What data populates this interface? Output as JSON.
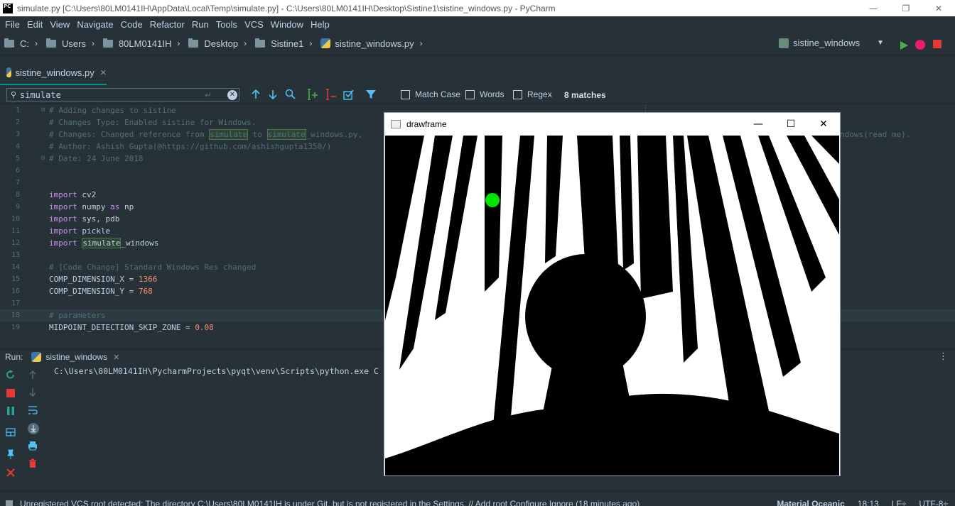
{
  "window": {
    "title": "simulate.py [C:\\Users\\80LM0141IH\\AppData\\Local\\Temp\\simulate.py] - C:\\Users\\80LM0141IH\\Desktop\\Sistine1\\sistine_windows.py - PyCharm",
    "logo_text": "PC",
    "minimize": "—",
    "restore": "❐",
    "close": "✕"
  },
  "menu": [
    "File",
    "Edit",
    "View",
    "Navigate",
    "Code",
    "Refactor",
    "Run",
    "Tools",
    "VCS",
    "Window",
    "Help"
  ],
  "breadcrumb": [
    "C:",
    "Users",
    "80LM0141IH",
    "Desktop",
    "Sistine1",
    "sistine_windows.py"
  ],
  "run_config": {
    "name": "sistine_windows",
    "dropdown": "▼"
  },
  "editor_tab": {
    "label": "sistine_windows.py",
    "close": "✕"
  },
  "search": {
    "query": "simulate",
    "enter_glyph": "↵",
    "clear_glyph": "✕",
    "options": [
      "Match Case",
      "Words",
      "Regex"
    ],
    "matches": "8 matches"
  },
  "code_lines": [
    {
      "n": "1",
      "text": "# Adding changes to sistine"
    },
    {
      "n": "2",
      "text": "# Changes Type: Enabled sistine for Windows."
    },
    {
      "n": "3",
      "text": "# Changes: Changed reference from simulate to simulate_windows.py,",
      "tail": "ndows(read me)."
    },
    {
      "n": "4",
      "text": "# Author: Ashish Gupta(@https://github.com/ashishgupta1350/)"
    },
    {
      "n": "5",
      "text": "# Date: 24 June 2018"
    },
    {
      "n": "6",
      "text": ""
    },
    {
      "n": "7",
      "text": ""
    },
    {
      "n": "8",
      "text": "import cv2"
    },
    {
      "n": "9",
      "text": "import numpy as np"
    },
    {
      "n": "10",
      "text": "import sys, pdb"
    },
    {
      "n": "11",
      "text": "import pickle"
    },
    {
      "n": "12",
      "text": "import simulate_windows"
    },
    {
      "n": "13",
      "text": ""
    },
    {
      "n": "14",
      "text": "# [Code Change] Standard Windows Res changed"
    },
    {
      "n": "15",
      "text": "COMP_DIMENSION_X = 1366"
    },
    {
      "n": "16",
      "text": "COMP_DIMENSION_Y = 768"
    },
    {
      "n": "17",
      "text": ""
    },
    {
      "n": "18",
      "text": "# parameters"
    },
    {
      "n": "19",
      "text": "MIDPOINT_DETECTION_SKIP_ZONE = 0.08"
    }
  ],
  "run_panel": {
    "label": "Run:",
    "tab": "sistine_windows",
    "close": "✕",
    "output": "C:\\Users\\80LM0141IH\\PycharmProjects\\pyqt\\venv\\Scripts\\python.exe C"
  },
  "status": {
    "message": "Unregistered VCS root detected: The directory C:\\Users\\80LM0141IH is under Git, but is not registered in the Settings. // Add root  Configure  Ignore (18 minutes ago)",
    "theme": "Material Oceanic",
    "position": "18:13",
    "line_sep": "LF÷",
    "encoding": "UTF-8÷"
  },
  "cv_window": {
    "title": "drawframe",
    "minimize": "—",
    "maximize": "☐",
    "close": "✕"
  },
  "colors": {
    "bg": "#263238",
    "text": "#c3cee3",
    "comment": "#546e7a",
    "keyword": "#c792ea",
    "number": "#f78c6c",
    "accent": "#009688",
    "marker_green": "#00e600"
  }
}
